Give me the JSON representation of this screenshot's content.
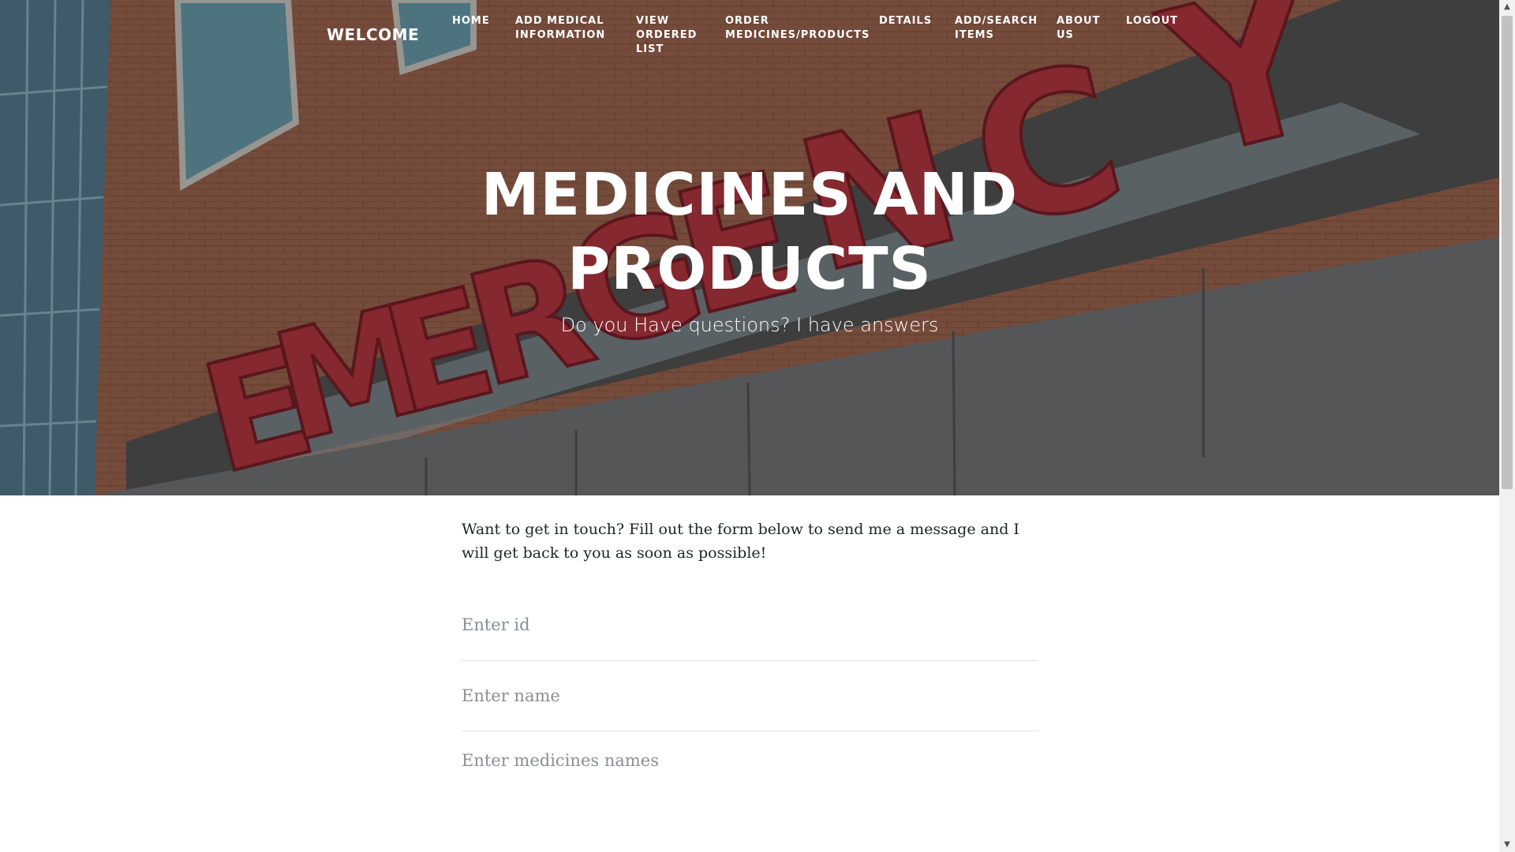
{
  "nav": {
    "brand": "WELCOME",
    "items": [
      {
        "label": "HOME"
      },
      {
        "label": "ADD MEDICAL INFORMATION"
      },
      {
        "label": "VIEW ORDERED LIST"
      },
      {
        "label": "ORDER MEDICINES/PRODUCTS"
      },
      {
        "label": "DETAILS"
      },
      {
        "label": "ADD/SEARCH ITEMS"
      },
      {
        "label": "ABOUT US"
      },
      {
        "label": "LOGOUT"
      }
    ]
  },
  "hero": {
    "title": "MEDICINES AND PRODUCTS",
    "subtitle": "Do you Have questions? I have answers",
    "sign_text": "EMERGENCY"
  },
  "form": {
    "intro": "Want to get in touch? Fill out the form below to send me a message and I will get back to you as soon as possible!",
    "id_placeholder": "Enter id",
    "name_placeholder": "Enter name",
    "medicines_placeholder": "Enter medicines names"
  },
  "colors": {
    "brick": "#8a5a48",
    "sign_red": "#a3313b",
    "panel_gray": "#5d6062",
    "text_dark": "#212529",
    "placeholder": "#8a8f95"
  },
  "icons": {
    "scroll_up": "triangle-up",
    "scroll_down": "triangle-down"
  }
}
